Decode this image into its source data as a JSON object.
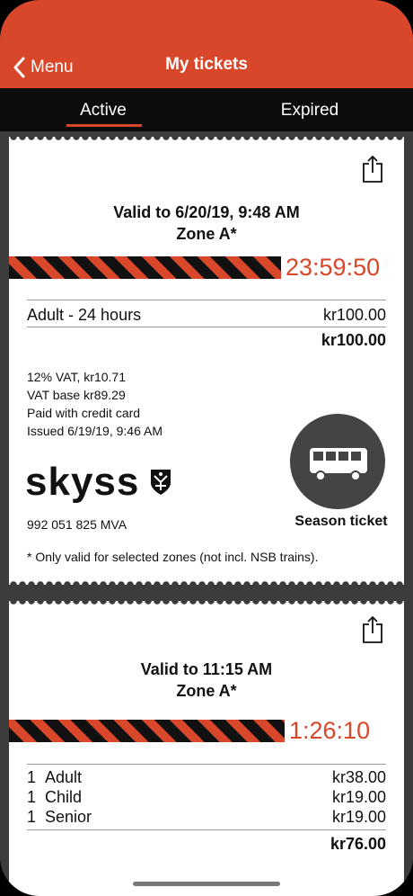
{
  "header": {
    "back_label": "Menu",
    "title": "My tickets",
    "color": "#d9472b"
  },
  "tabs": [
    {
      "label": "Active",
      "selected": true
    },
    {
      "label": "Expired",
      "selected": false
    }
  ],
  "tickets": [
    {
      "valid_line": "Valid to 6/20/19, 9:48 AM",
      "zone": "Zone A*",
      "countdown": "23:59:50",
      "items": [
        {
          "label": "Adult - 24 hours",
          "price": "kr100.00"
        }
      ],
      "total": "kr100.00",
      "details": [
        "12% VAT, kr10.71",
        "VAT base kr89.29",
        "Paid with credit card",
        "Issued 6/19/19, 9:46 AM"
      ],
      "brand": "skyss",
      "org_number": "992 051 825 MVA",
      "ticket_type": "Season ticket",
      "footnote": "* Only valid for selected zones (not incl. NSB trains)."
    },
    {
      "valid_line": "Valid to 11:15 AM",
      "zone": "Zone A*",
      "countdown": "1:26:10",
      "items": [
        {
          "qty": "1",
          "label": "Adult",
          "price": "kr38.00"
        },
        {
          "qty": "1",
          "label": "Child",
          "price": "kr19.00"
        },
        {
          "qty": "1",
          "label": "Senior",
          "price": "kr19.00"
        }
      ],
      "total": "kr76.00"
    }
  ],
  "icons": {
    "back": "chevron-left-icon",
    "share": "share-icon",
    "crest": "shield-crest-icon",
    "bus": "bus-icon"
  }
}
